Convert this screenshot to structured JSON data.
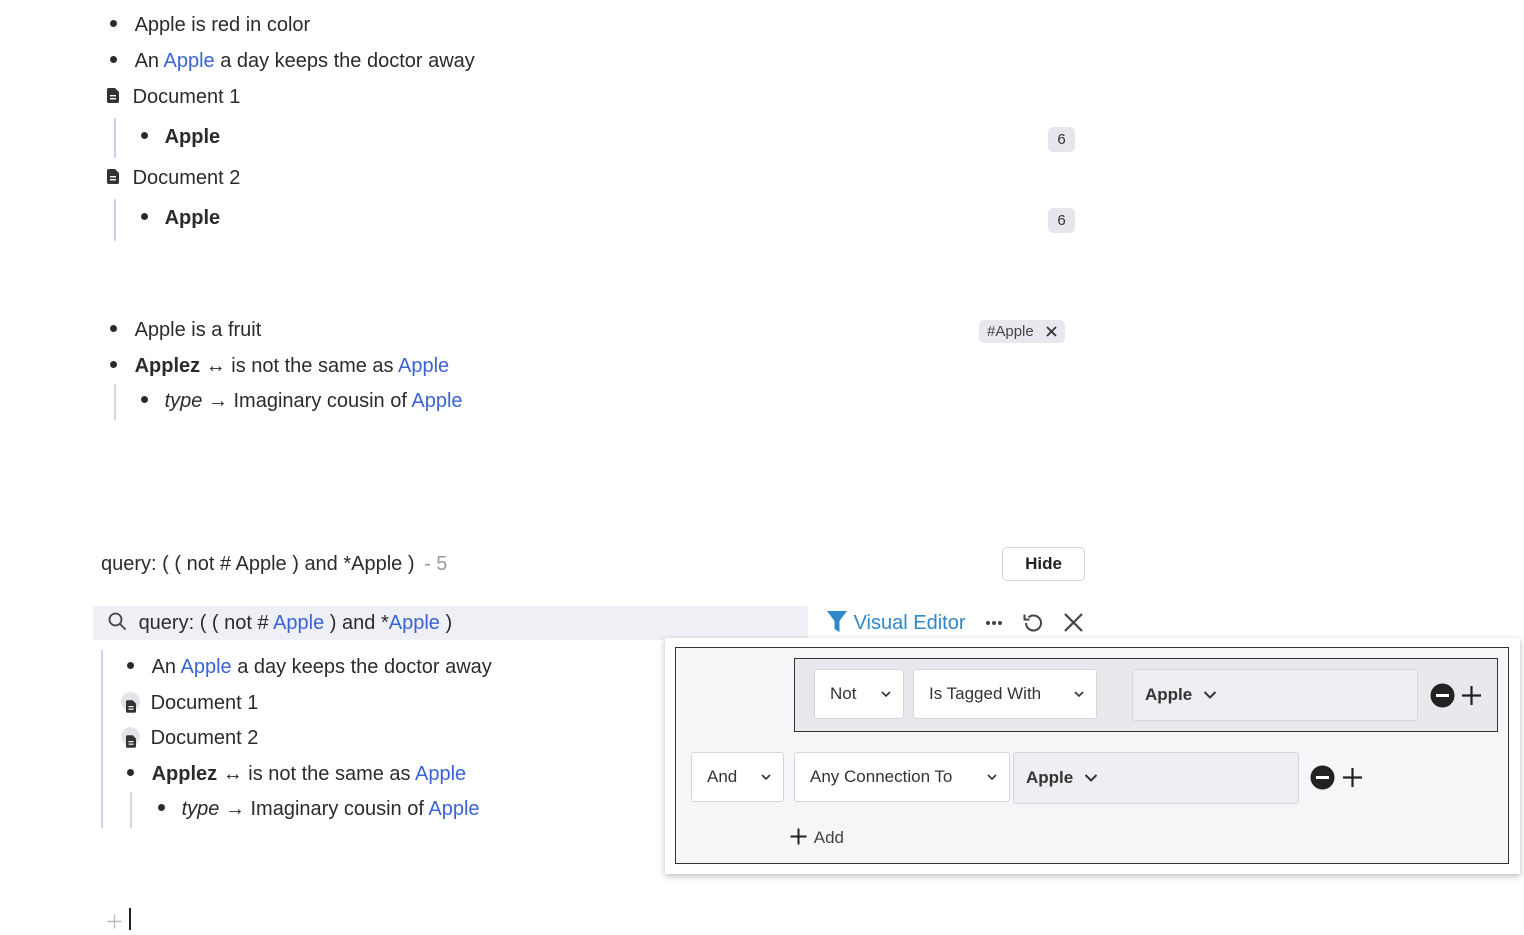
{
  "top_bullets": {
    "b1": "Apple is red in color",
    "b2_pre": "An",
    "b2_link": "Apple",
    "b2_post": "a day keeps the doctor away"
  },
  "documents": [
    {
      "title": "Document 1",
      "child": "Apple",
      "count": "6"
    },
    {
      "title": "Document 2",
      "child": "Apple",
      "count": "6"
    }
  ],
  "mid_bullets": {
    "fruit": "Apple is a fruit",
    "tag_chip": "#Apple",
    "applez": "Applez",
    "arrow_both": "↔",
    "not_same": "is not the same as",
    "apple_link": "Apple",
    "type": "type",
    "arrow_right": "→",
    "cousin": "Imaginary cousin of",
    "cousin_link": "Apple"
  },
  "query": {
    "title": "query: ( ( not # Apple ) and *Apple )",
    "count_sep": "- 5",
    "hide_label": "Hide",
    "search_prefix": "query: (  ( not #",
    "search_link1": "Apple",
    "search_mid": ") and  *",
    "search_link2": "Apple",
    "search_suffix": ")",
    "visual_editor": "Visual Editor"
  },
  "results": {
    "r1_pre": "An",
    "r1_link": "Apple",
    "r1_post": "a day keeps the doctor away",
    "doc1": "Document 1",
    "doc2": "Document 2",
    "applez": "Applez",
    "arrow_both": "↔",
    "not_same": "is not the same as",
    "apple_link": "Apple",
    "type": "type",
    "arrow_right": "→",
    "cousin": "Imaginary cousin of",
    "cousin_link": "Apple"
  },
  "editor": {
    "row1": {
      "negation": "Not",
      "operator": "Is Tagged With",
      "value": "Apple"
    },
    "row2": {
      "conjunction": "And",
      "operator": "Any Connection To",
      "value": "Apple"
    },
    "add_label": "Add"
  },
  "colors": {
    "link": "#3a63d6",
    "visual_editor": "#2e88c9",
    "indent_bar": "#c9d2f5"
  }
}
